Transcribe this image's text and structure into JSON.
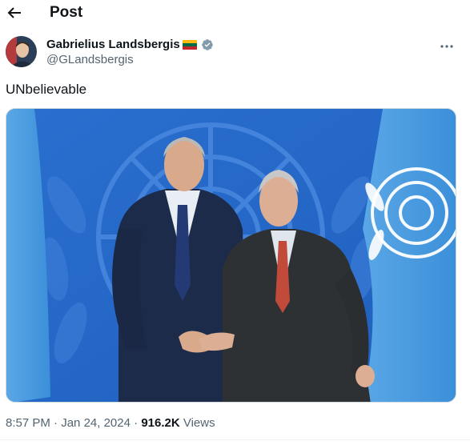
{
  "header": {
    "title": "Post",
    "back_icon": "arrow-left-icon"
  },
  "author": {
    "name": "Gabrielius Landsbergis",
    "handle": "@GLandsbergis",
    "flag_icon": "lithuania-flag-icon",
    "verified_icon": "verified-badge-icon",
    "verified_color": "#829aab"
  },
  "more_icon": "more-options-icon",
  "post": {
    "text": "UNbelievable",
    "media_description_icon": "photo"
  },
  "meta": {
    "time": "8:57 PM",
    "separator": "·",
    "date": "Jan 24, 2024",
    "views_count": "916.2K",
    "views_label": "Views"
  },
  "colors": {
    "text_primary": "#0f1419",
    "text_secondary": "#536471",
    "un_blue": "#2f77d6",
    "flag_yellow": "#fdb913",
    "flag_green": "#006a44",
    "flag_red": "#c1272d"
  }
}
